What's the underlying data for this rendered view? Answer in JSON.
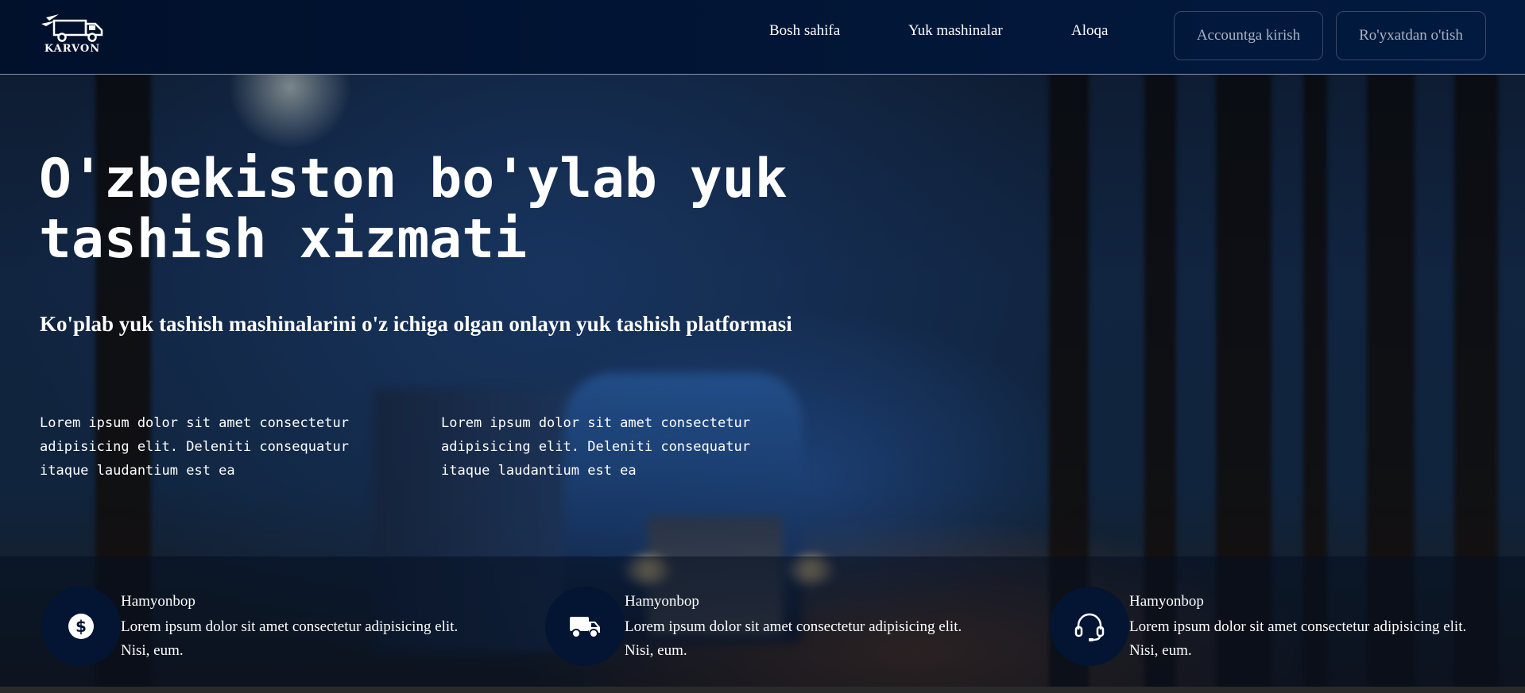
{
  "header": {
    "logo_text": "KARVON",
    "nav": [
      {
        "label": "Bosh sahifa"
      },
      {
        "label": "Yuk mashinalar"
      },
      {
        "label": "Aloqa"
      }
    ],
    "login_label": "Accountga kirish",
    "register_label": "Ro'yxatdan o'tish"
  },
  "hero": {
    "title": "O'zbekiston bo'ylab yuk tashish xizmati",
    "subtitle": "Ko'plab yuk tashish mashinalarini o'z ichiga olgan onlayn yuk tashish platformasi",
    "paragraphs": [
      "Lorem ipsum dolor sit amet consectetur adipisicing elit. Deleniti consequatur itaque laudantium est ea",
      "Lorem ipsum dolor sit amet consectetur adipisicing elit. Deleniti consequatur itaque laudantium est ea"
    ]
  },
  "features": [
    {
      "icon": "dollar-icon",
      "title": "Hamyonbop",
      "desc": "Lorem ipsum dolor sit amet consectetur adipisicing elit. Nisi, eum."
    },
    {
      "icon": "truck-icon",
      "title": "Hamyonbop",
      "desc": "Lorem ipsum dolor sit amet consectetur adipisicing elit. Nisi, eum."
    },
    {
      "icon": "headset-icon",
      "title": "Hamyonbop",
      "desc": "Lorem ipsum dolor sit amet consectetur adipisicing elit. Nisi, eum."
    }
  ],
  "colors": {
    "navbar": "#021a40",
    "icon_circle": "#031533",
    "text": "#ffffff",
    "button_text": "#a9b2c2"
  }
}
